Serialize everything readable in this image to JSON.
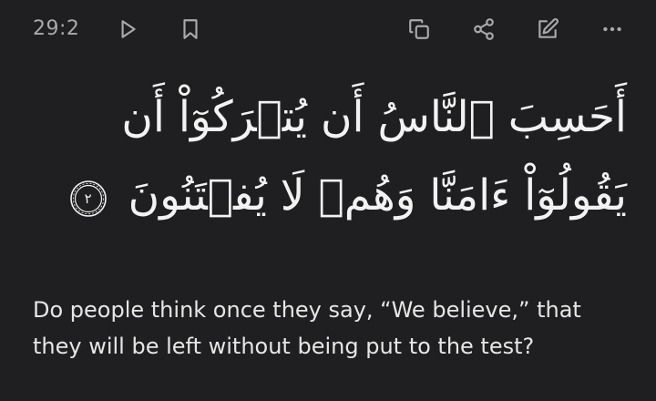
{
  "toolbar": {
    "verse_ref": "29:2",
    "icons": {
      "play": "play-icon",
      "bookmark": "bookmark-icon",
      "copy": "copy-icon",
      "share": "share-icon",
      "edit": "edit-icon",
      "more": "more-horizontal-icon"
    }
  },
  "verse": {
    "arabic": "أَحَسِبَ ٱلنَّاسُ أَن يُتۡرَكُوٓاْ أَن يَقُولُوٓاْ ءَامَنَّا وَهُمۡ لَا يُفۡتَنُونَ",
    "ayah_number": "٢",
    "translation": "Do people think once they say, “We believe,” that they will be left without being put to the test?"
  },
  "colors": {
    "background": "#1f1f21",
    "icon": "#a9a9ab",
    "text": "#e8e8e8"
  }
}
